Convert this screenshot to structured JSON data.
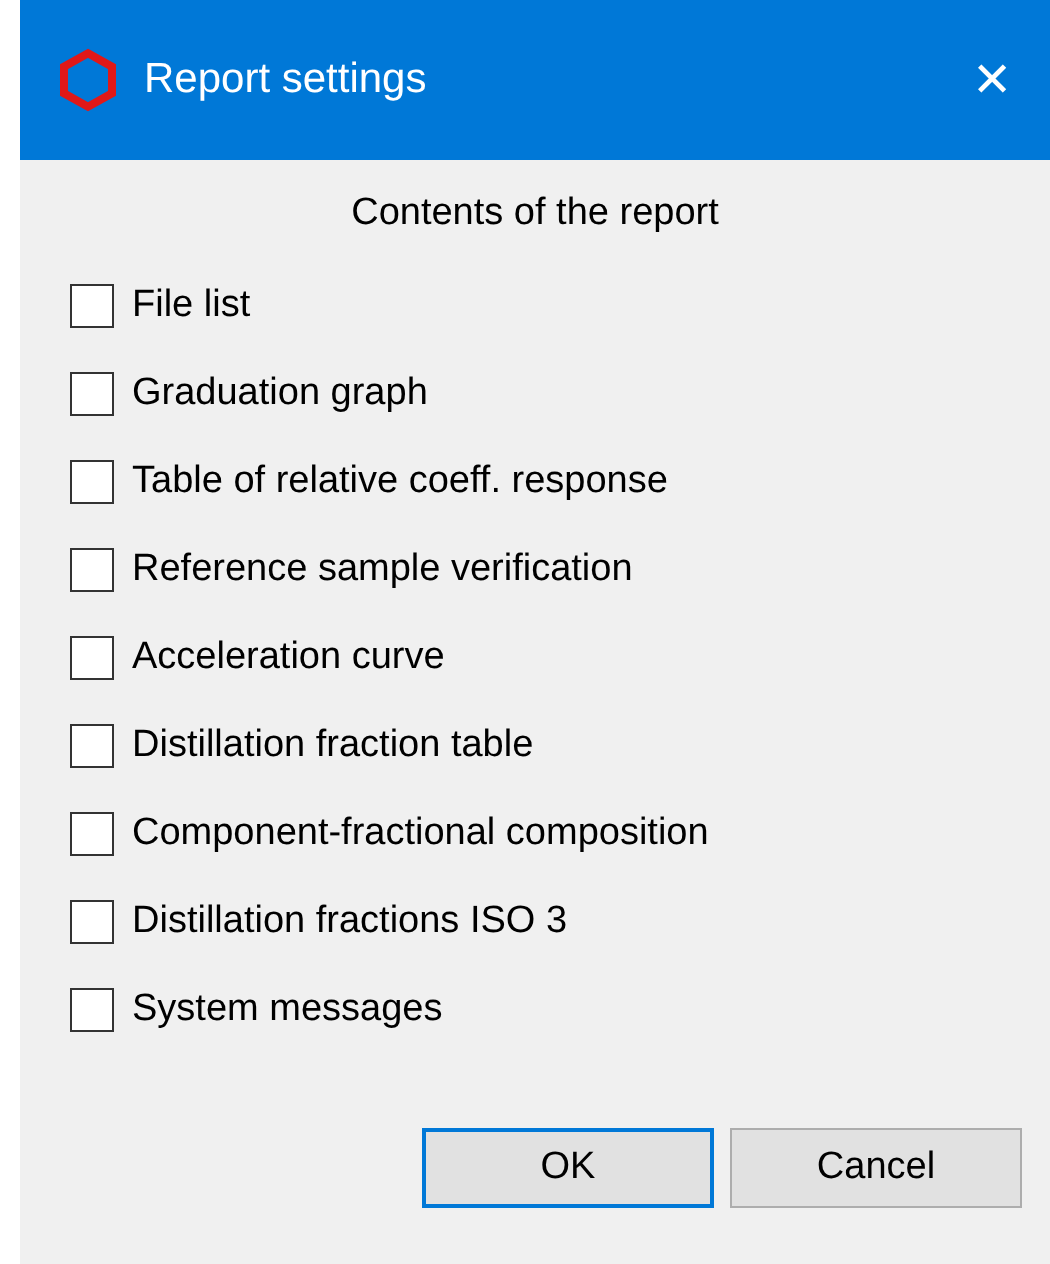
{
  "window": {
    "title": "Report settings",
    "close": "✕"
  },
  "heading": "Contents of the report",
  "options": [
    {
      "label": "File list",
      "checked": false
    },
    {
      "label": "Graduation graph",
      "checked": false
    },
    {
      "label": "Table of relative coeff. response",
      "checked": false
    },
    {
      "label": "Reference sample verification",
      "checked": false
    },
    {
      "label": "Acceleration curve",
      "checked": false
    },
    {
      "label": "Distillation fraction table",
      "checked": false
    },
    {
      "label": "Component-fractional composition",
      "checked": false
    },
    {
      "label": "Distillation fractions ISO 3",
      "checked": false
    },
    {
      "label": "System messages",
      "checked": false
    }
  ],
  "buttons": [
    {
      "label": "OK",
      "default": true
    },
    {
      "label": "Cancel",
      "default": false
    }
  ]
}
